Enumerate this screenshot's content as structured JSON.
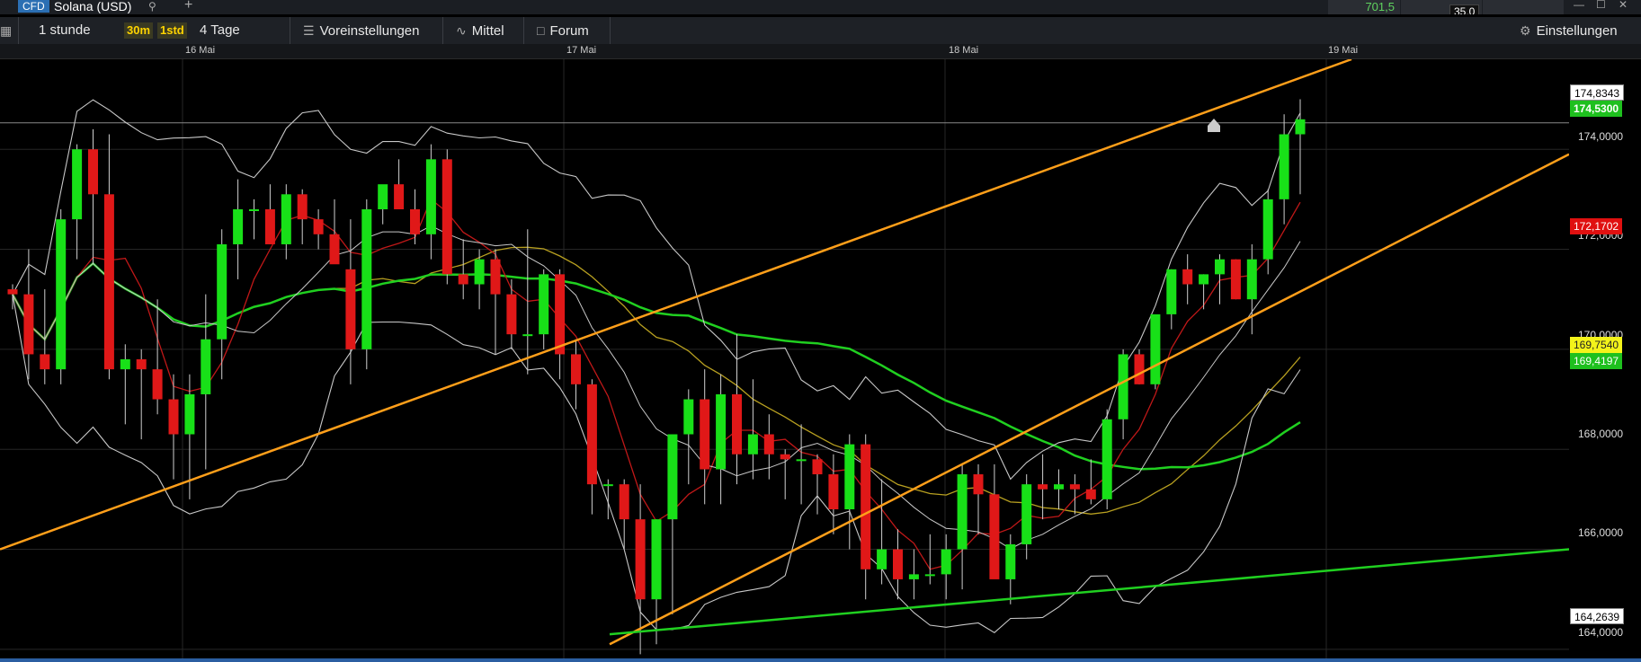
{
  "topbar": {
    "cfd_label": "CFD",
    "instrument": "Solana (USD)",
    "sell_price": "701,5",
    "spread": "35,0"
  },
  "toolbar": {
    "interval": "1 stunde",
    "badge_30m": "30m",
    "badge_1std": "1std",
    "range": "4 Tage",
    "presets": "Voreinstellungen",
    "indicators": "Mittel",
    "forum": "Forum",
    "settings": "Einstellungen"
  },
  "dates": [
    "16 Mai",
    "17 Mai",
    "18 Mai",
    "19 Mai"
  ],
  "axis": {
    "ticks": [
      "174,0000",
      "172,0000",
      "170,0000",
      "168,0000",
      "166,0000",
      "164,0000"
    ],
    "labels": {
      "high": "174,8343",
      "last": "174,5300",
      "red": "172,1702",
      "yellow": "169,7540",
      "green": "169,4197",
      "low": "164,2639"
    }
  },
  "colors": {
    "up": "#18e018",
    "down": "#e01818",
    "trend_orange": "#ff9f1a",
    "trend_green": "#20d020",
    "ma_yellow": "#b8a020",
    "ma_red": "#c01818",
    "band_white": "#c8c8c8",
    "label_red": "#e01010",
    "label_yellow": "#f3f31a",
    "label_green": "#1ec01e"
  },
  "chart_data": {
    "type": "candlestick",
    "ylim": [
      163.8,
      175.8
    ],
    "candles": [
      [
        171.2,
        171.3,
        170.8,
        171.1
      ],
      [
        171.1,
        172.0,
        169.4,
        169.9
      ],
      [
        169.9,
        171.2,
        169.3,
        169.6
      ],
      [
        169.6,
        172.8,
        169.3,
        172.6
      ],
      [
        172.6,
        174.1,
        171.8,
        174.0
      ],
      [
        174.0,
        174.4,
        171.7,
        173.1
      ],
      [
        173.1,
        174.3,
        169.4,
        169.6
      ],
      [
        169.6,
        170.1,
        168.5,
        169.8
      ],
      [
        169.8,
        170.0,
        168.2,
        169.6
      ],
      [
        169.6,
        171.0,
        168.7,
        169.0
      ],
      [
        169.0,
        169.5,
        167.4,
        168.3
      ],
      [
        168.3,
        169.5,
        167.0,
        169.1
      ],
      [
        169.1,
        171.1,
        167.6,
        170.2
      ],
      [
        170.2,
        172.4,
        169.4,
        172.1
      ],
      [
        172.1,
        173.4,
        171.4,
        172.8
      ],
      [
        172.8,
        173.0,
        172.2,
        172.8
      ],
      [
        172.8,
        173.3,
        172.1,
        172.1
      ],
      [
        172.1,
        173.3,
        171.8,
        173.1
      ],
      [
        173.1,
        173.2,
        172.1,
        172.6
      ],
      [
        172.6,
        172.8,
        172.0,
        172.3
      ],
      [
        172.3,
        173.0,
        171.8,
        171.7
      ],
      [
        171.6,
        172.6,
        169.3,
        170.0
      ],
      [
        170.0,
        173.0,
        169.6,
        172.8
      ],
      [
        172.8,
        173.2,
        172.5,
        173.3
      ],
      [
        173.3,
        173.8,
        172.8,
        172.8
      ],
      [
        172.8,
        173.2,
        172.1,
        172.3
      ],
      [
        172.3,
        174.1,
        171.8,
        173.8
      ],
      [
        173.8,
        174.0,
        171.3,
        171.5
      ],
      [
        171.5,
        172.2,
        171.0,
        171.3
      ],
      [
        171.3,
        172.0,
        170.8,
        171.8
      ],
      [
        171.8,
        172.0,
        169.9,
        171.1
      ],
      [
        171.1,
        171.4,
        170.0,
        170.3
      ],
      [
        170.3,
        172.4,
        169.5,
        170.3
      ],
      [
        170.3,
        171.6,
        170.0,
        171.5
      ],
      [
        171.5,
        171.6,
        169.4,
        169.9
      ],
      [
        169.9,
        170.2,
        168.8,
        169.3
      ],
      [
        169.3,
        169.4,
        166.7,
        167.3
      ],
      [
        167.3,
        167.4,
        166.6,
        167.3
      ],
      [
        167.3,
        167.4,
        166.0,
        166.6
      ],
      [
        166.6,
        167.3,
        163.9,
        165.0
      ],
      [
        165.0,
        166.6,
        164.1,
        166.6
      ],
      [
        166.6,
        168.3,
        164.7,
        168.3
      ],
      [
        168.3,
        169.2,
        167.3,
        169.0
      ],
      [
        169.0,
        169.6,
        166.9,
        167.6
      ],
      [
        167.6,
        169.5,
        166.9,
        169.1
      ],
      [
        169.1,
        170.3,
        167.3,
        167.9
      ],
      [
        167.9,
        169.4,
        167.4,
        168.3
      ],
      [
        168.3,
        168.7,
        167.4,
        167.9
      ],
      [
        167.9,
        168.0,
        167.0,
        167.8
      ],
      [
        167.8,
        168.5,
        166.9,
        167.8
      ],
      [
        167.8,
        167.9,
        166.7,
        167.5
      ],
      [
        167.5,
        167.9,
        166.3,
        166.8
      ],
      [
        166.8,
        168.3,
        166.0,
        168.1
      ],
      [
        168.1,
        168.3,
        165.0,
        165.6
      ],
      [
        165.6,
        167.4,
        165.3,
        166.0
      ],
      [
        166.0,
        166.4,
        165.0,
        165.4
      ],
      [
        165.4,
        166.0,
        165.0,
        165.5
      ],
      [
        165.5,
        166.3,
        165.3,
        165.5
      ],
      [
        165.5,
        166.3,
        165.0,
        166.0
      ],
      [
        166.0,
        167.7,
        165.2,
        167.5
      ],
      [
        167.5,
        167.7,
        166.3,
        167.1
      ],
      [
        167.1,
        167.7,
        165.5,
        165.4
      ],
      [
        165.4,
        166.3,
        164.9,
        166.1
      ],
      [
        166.1,
        167.5,
        165.8,
        167.3
      ],
      [
        167.3,
        167.9,
        166.6,
        167.2
      ],
      [
        167.2,
        167.6,
        166.8,
        167.3
      ],
      [
        167.3,
        167.5,
        166.7,
        167.2
      ],
      [
        167.2,
        167.8,
        166.9,
        167.0
      ],
      [
        167.0,
        168.8,
        166.8,
        168.6
      ],
      [
        168.6,
        170.0,
        168.2,
        169.9
      ],
      [
        169.9,
        170.0,
        169.3,
        169.3
      ],
      [
        169.3,
        170.6,
        169.2,
        170.7
      ],
      [
        170.7,
        171.6,
        170.4,
        171.6
      ],
      [
        171.6,
        171.9,
        170.9,
        171.3
      ],
      [
        171.3,
        171.5,
        170.8,
        171.5
      ],
      [
        171.5,
        171.9,
        170.9,
        171.8
      ],
      [
        171.8,
        171.8,
        171.0,
        171.0
      ],
      [
        171.0,
        172.1,
        170.3,
        171.8
      ],
      [
        171.8,
        173.2,
        171.5,
        173.0
      ],
      [
        173.0,
        174.7,
        172.5,
        174.3
      ],
      [
        174.3,
        175.0,
        173.1,
        174.6
      ]
    ]
  }
}
